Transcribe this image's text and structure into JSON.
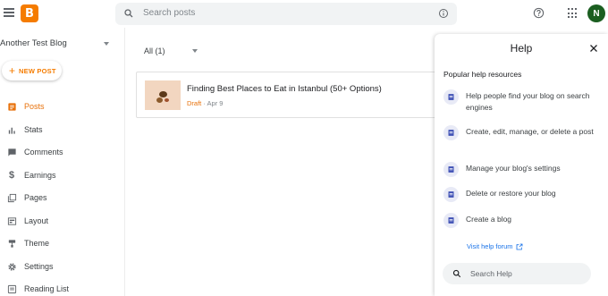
{
  "topbar": {
    "search_placeholder": "Search posts",
    "avatar_initial": "N"
  },
  "sidebar": {
    "blog_name": "Another Test Blog",
    "new_post_label": "NEW POST",
    "items": [
      {
        "label": "Posts",
        "icon": "posts-icon",
        "active": true
      },
      {
        "label": "Stats",
        "icon": "stats-icon"
      },
      {
        "label": "Comments",
        "icon": "comments-icon"
      },
      {
        "label": "Earnings",
        "icon": "dollar-icon"
      },
      {
        "label": "Pages",
        "icon": "pages-icon"
      },
      {
        "label": "Layout",
        "icon": "layout-icon"
      },
      {
        "label": "Theme",
        "icon": "theme-icon"
      },
      {
        "label": "Settings",
        "icon": "gear-icon"
      },
      {
        "label": "Reading List",
        "icon": "reading-list-icon"
      }
    ]
  },
  "main": {
    "filter_label": "All (1)",
    "posts": [
      {
        "title": "Finding Best Places to Eat in Istanbul (50+ Options)",
        "status": "Draft",
        "date": "Apr 9"
      }
    ]
  },
  "help": {
    "title": "Help",
    "subtitle": "Popular help resources",
    "resources": [
      {
        "label": "Help people find your blog on search engines"
      },
      {
        "label": "Create, edit, manage, or delete a post"
      },
      {
        "label": "Manage your blog's settings"
      },
      {
        "label": "Delete or restore your blog"
      },
      {
        "label": "Create a blog"
      }
    ],
    "forum_link": "Visit help forum",
    "search_placeholder": "Search Help"
  },
  "colors": {
    "accent": "#e8710a",
    "link": "#1a73e8",
    "avatar_bg": "#1b5e20"
  }
}
